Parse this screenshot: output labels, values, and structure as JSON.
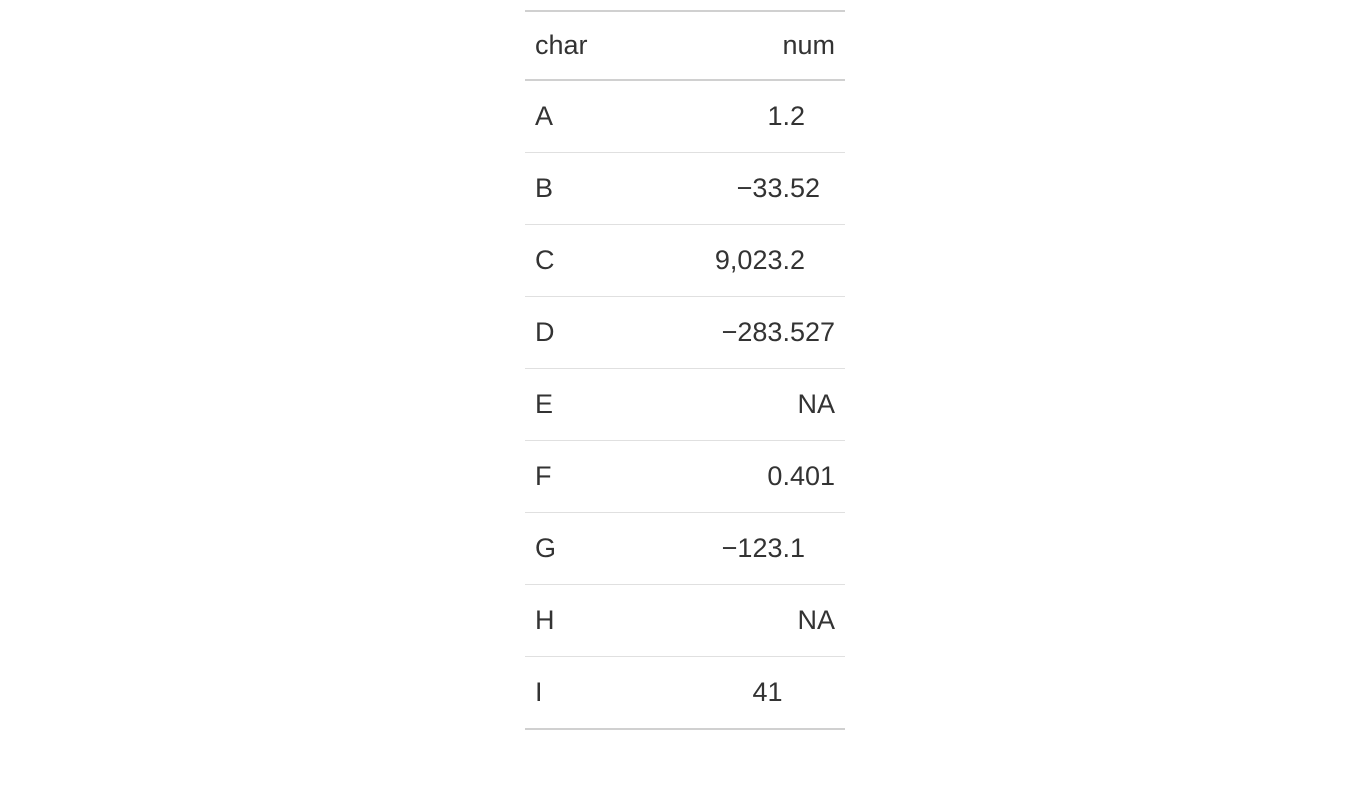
{
  "chart_data": {
    "type": "table",
    "columns": [
      "char",
      "num"
    ],
    "rows": [
      {
        "char": "A",
        "num": 1.2
      },
      {
        "char": "B",
        "num": -33.52
      },
      {
        "char": "C",
        "num": 9023.2
      },
      {
        "char": "D",
        "num": -283.527
      },
      {
        "char": "E",
        "num": null
      },
      {
        "char": "F",
        "num": 0.401
      },
      {
        "char": "G",
        "num": -123.1
      },
      {
        "char": "H",
        "num": null
      },
      {
        "char": "I",
        "num": 41
      }
    ]
  },
  "table": {
    "headers": {
      "char": "char",
      "num": "num"
    },
    "rows": [
      {
        "char": "A",
        "num_display": "1.2    "
      },
      {
        "char": "B",
        "num_display": "−33.52  "
      },
      {
        "char": "C",
        "num_display": "9,023.2    "
      },
      {
        "char": "D",
        "num_display": "−283.527"
      },
      {
        "char": "E",
        "num_display": "NA"
      },
      {
        "char": "F",
        "num_display": "0.401"
      },
      {
        "char": "G",
        "num_display": "−123.1    "
      },
      {
        "char": "H",
        "num_display": "NA"
      },
      {
        "char": "I",
        "num_display": "41       "
      }
    ]
  }
}
